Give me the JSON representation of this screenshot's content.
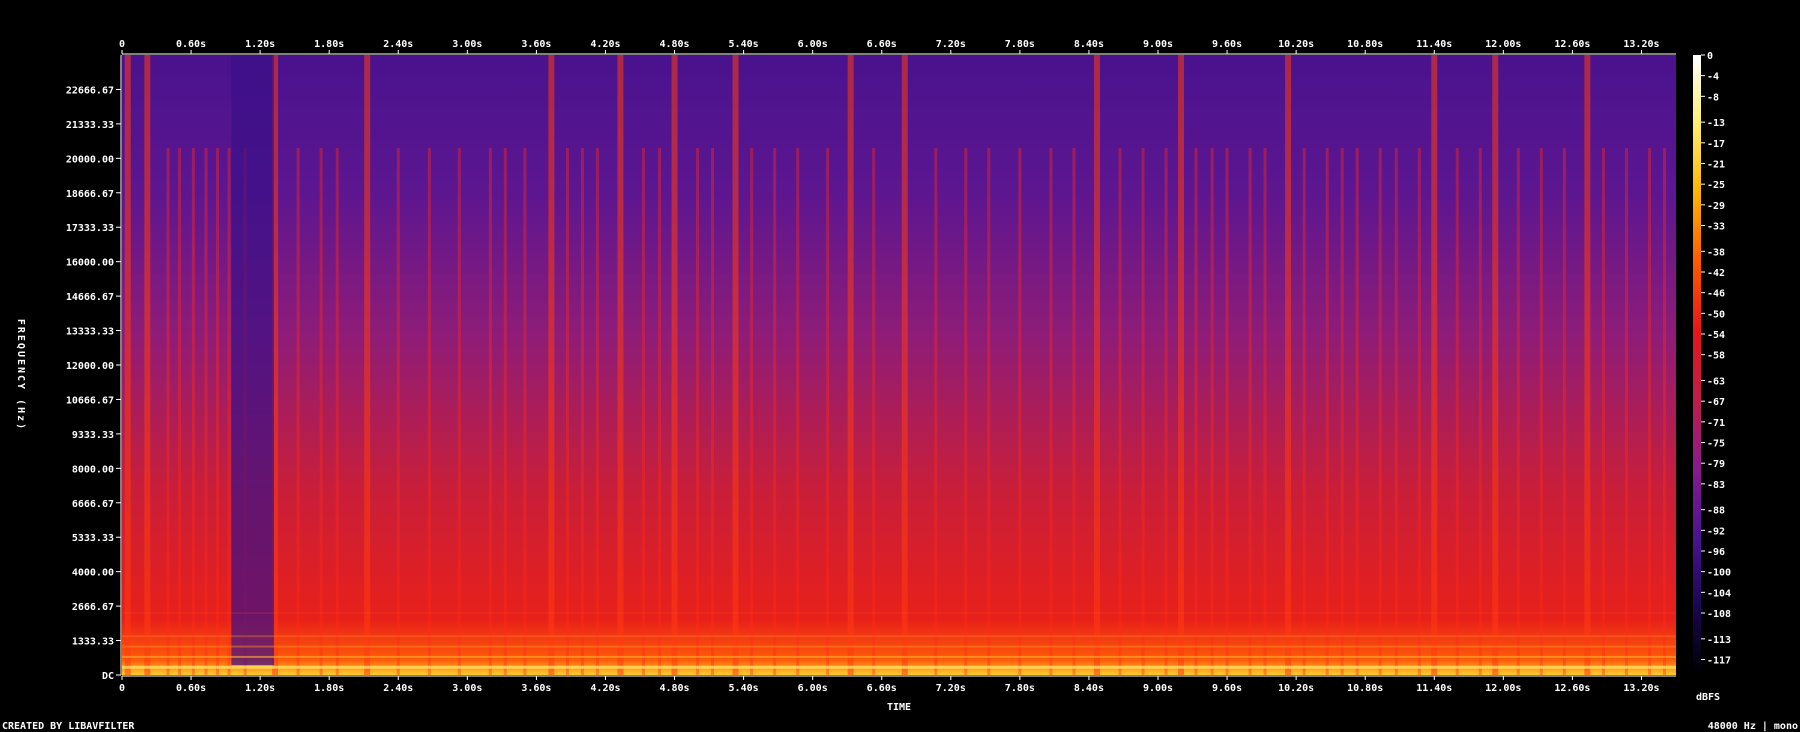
{
  "chart_data": {
    "type": "heatmap",
    "xlabel": "TIME",
    "ylabel": "FREQUENCY (Hz)",
    "colorbar_label": "dBFS",
    "x_ticks": [
      "0",
      "0.60s",
      "1.20s",
      "1.80s",
      "2.40s",
      "3.00s",
      "3.60s",
      "4.20s",
      "4.80s",
      "5.40s",
      "6.00s",
      "6.60s",
      "7.20s",
      "7.80s",
      "8.40s",
      "9.00s",
      "9.60s",
      "10.20s",
      "10.80s",
      "11.40s",
      "12.00s",
      "12.60s",
      "13.20s"
    ],
    "x_tick_values": [
      0,
      0.6,
      1.2,
      1.8,
      2.4,
      3.0,
      3.6,
      4.2,
      4.8,
      5.4,
      6.0,
      6.6,
      7.2,
      7.8,
      8.4,
      9.0,
      9.6,
      10.2,
      10.8,
      11.4,
      12.0,
      12.6,
      13.2
    ],
    "xlim": [
      0,
      13.5
    ],
    "y_ticks": [
      "DC",
      "1333.33",
      "2666.67",
      "4000.00",
      "5333.33",
      "6666.67",
      "8000.00",
      "9333.33",
      "10666.67",
      "12000.00",
      "13333.33",
      "14666.67",
      "16000.00",
      "17333.33",
      "18666.67",
      "20000.00",
      "21333.33",
      "22666.67"
    ],
    "y_tick_values": [
      0,
      1333.33,
      2666.67,
      4000,
      5333.33,
      6666.67,
      8000,
      9333.33,
      10666.67,
      12000,
      13333.33,
      14666.67,
      16000,
      17333.33,
      18666.67,
      20000,
      21333.33,
      22666.67
    ],
    "ylim": [
      0,
      24000
    ],
    "colorbar_ticks": [
      "0",
      "-4",
      "-8",
      "-13",
      "-17",
      "-21",
      "-25",
      "-29",
      "-33",
      "-38",
      "-42",
      "-46",
      "-50",
      "-54",
      "-58",
      "-63",
      "-67",
      "-71",
      "-75",
      "-79",
      "-83",
      "-88",
      "-92",
      "-96",
      "-100",
      "-104",
      "-108",
      "-113",
      "-117"
    ],
    "colorbar_tick_values": [
      0,
      -4,
      -8,
      -13,
      -17,
      -21,
      -25,
      -29,
      -33,
      -38,
      -42,
      -46,
      -50,
      -54,
      -58,
      -63,
      -67,
      -71,
      -75,
      -79,
      -83,
      -88,
      -92,
      -96,
      -100,
      -104,
      -108,
      -113,
      -117
    ],
    "colorbar_range": [
      -120,
      0
    ],
    "colormap": [
      "#000000",
      "#1a0650",
      "#4a1491",
      "#8a1a8c",
      "#c01d4a",
      "#e8151a",
      "#ff5a00",
      "#ffb400",
      "#ffee70",
      "#ffffff"
    ],
    "onsets_s": [
      0.05,
      0.22,
      0.4,
      0.5,
      0.62,
      0.73,
      0.83,
      0.93,
      1.07,
      1.33,
      1.53,
      1.73,
      1.87,
      2.13,
      2.4,
      2.67,
      2.93,
      3.2,
      3.33,
      3.5,
      3.73,
      3.87,
      4.0,
      4.13,
      4.33,
      4.53,
      4.67,
      4.8,
      5.0,
      5.13,
      5.33,
      5.47,
      5.67,
      5.87,
      6.13,
      6.33,
      6.53,
      6.8,
      7.07,
      7.33,
      7.53,
      7.8,
      8.07,
      8.27,
      8.47,
      8.67,
      8.87,
      9.07,
      9.2,
      9.33,
      9.47,
      9.6,
      9.8,
      9.93,
      10.13,
      10.27,
      10.47,
      10.6,
      10.73,
      10.93,
      11.07,
      11.27,
      11.4,
      11.6,
      11.8,
      11.93,
      12.13,
      12.33,
      12.53,
      12.73,
      12.87,
      13.07,
      13.27,
      13.4
    ],
    "strong_onsets_s": [
      0.05,
      0.22,
      1.33,
      2.13,
      3.73,
      4.33,
      4.8,
      5.33,
      6.33,
      6.8,
      8.47,
      9.2,
      10.13,
      11.4,
      11.93,
      12.73
    ]
  },
  "footer": {
    "left": "CREATED BY LIBAVFILTER",
    "right": "48000 Hz | mono"
  }
}
